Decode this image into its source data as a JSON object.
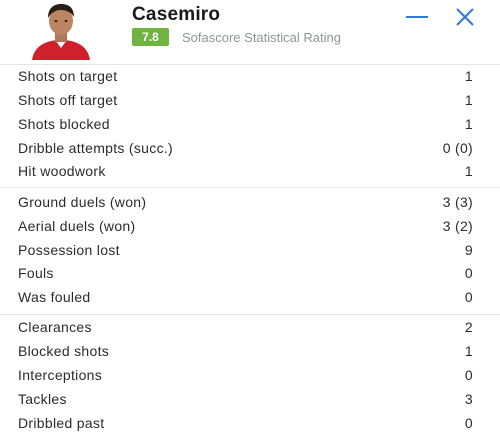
{
  "player": {
    "name": "Casemiro",
    "rating": "7.8",
    "rating_label": "Sofascore Statistical Rating"
  },
  "colors": {
    "rating_badge": "#6fb43f",
    "header_icons": "#2e7bd6",
    "divider": "#e4e6e8"
  },
  "icons": {
    "minimize": "minimize-icon",
    "close": "close-icon"
  },
  "groups": [
    {
      "rows": [
        {
          "label": "Shots on target",
          "value": "1"
        },
        {
          "label": "Shots off target",
          "value": "1"
        },
        {
          "label": "Shots blocked",
          "value": "1"
        },
        {
          "label": "Dribble attempts (succ.)",
          "value": "0 (0)"
        },
        {
          "label": "Hit woodwork",
          "value": "1"
        }
      ]
    },
    {
      "rows": [
        {
          "label": "Ground duels (won)",
          "value": "3 (3)"
        },
        {
          "label": "Aerial duels (won)",
          "value": "3 (2)"
        },
        {
          "label": "Possession lost",
          "value": "9"
        },
        {
          "label": "Fouls",
          "value": "0"
        },
        {
          "label": "Was fouled",
          "value": "0"
        }
      ]
    },
    {
      "rows": [
        {
          "label": "Clearances",
          "value": "2"
        },
        {
          "label": "Blocked shots",
          "value": "1"
        },
        {
          "label": "Interceptions",
          "value": "0"
        },
        {
          "label": "Tackles",
          "value": "3"
        },
        {
          "label": "Dribbled past",
          "value": "0"
        }
      ]
    }
  ]
}
